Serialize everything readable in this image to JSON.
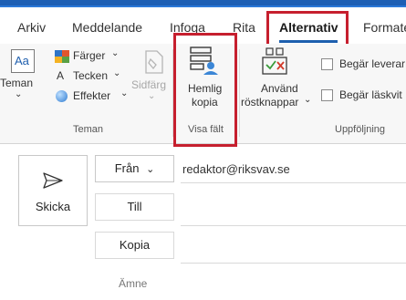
{
  "ribbon_tabs": [
    "Arkiv",
    "Meddelande",
    "Infoga",
    "Rita",
    "Alternativ",
    "Formate"
  ],
  "active_tab": "Alternativ",
  "groups": {
    "teman": {
      "label": "Teman",
      "theme_button": "Teman",
      "theme_icon_text": "Aa",
      "colors": "Färger",
      "fonts": "Tecken",
      "effects": "Effekter",
      "page_color": "Sidfärg"
    },
    "visa_falt": {
      "label": "Visa fält",
      "bcc_line1": "Hemlig",
      "bcc_line2": "kopia"
    },
    "uppfoljning": {
      "label": "Uppföljning",
      "voting_line1": "Använd",
      "voting_line2": "röstknappar",
      "request_delivery": "Begär leverar",
      "request_read": "Begär läskvit"
    }
  },
  "compose": {
    "send": "Skicka",
    "from": "Från",
    "from_value": "redaktor@riksvav.se",
    "to": "Till",
    "cc": "Kopia",
    "subject": "Ämne"
  },
  "colors": {
    "highlight_box": "#c61f2e",
    "accent_blue": "#1d5fae"
  }
}
